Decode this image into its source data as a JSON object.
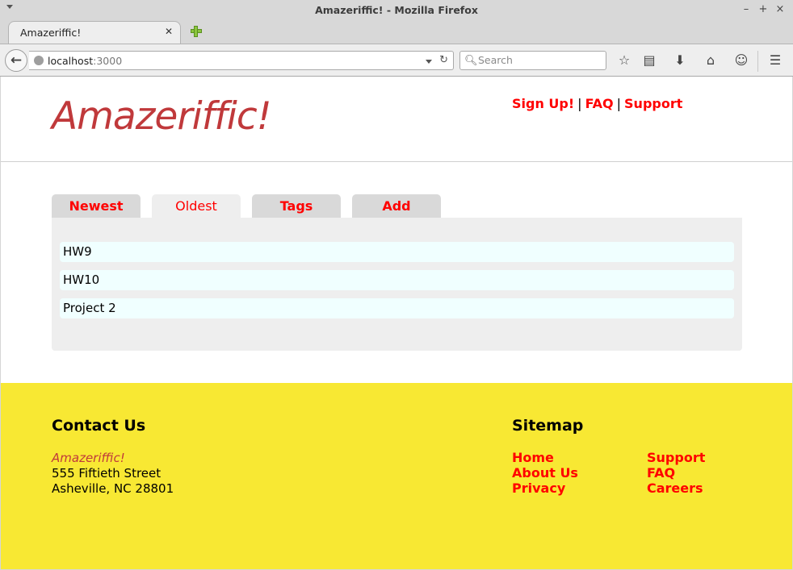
{
  "window": {
    "title": "Amazeriffic! - Mozilla Firefox",
    "controls": [
      "–",
      "+",
      "×"
    ]
  },
  "browser": {
    "tab_title": "Amazeriffic!",
    "url_host": "localhost",
    "url_port": ":3000",
    "search_placeholder": "Search"
  },
  "site": {
    "logo": "Amazeriffic!",
    "top_links": {
      "signup": "Sign Up!",
      "faq": "FAQ",
      "support": "Support",
      "separator": "|"
    },
    "tabs": [
      {
        "label": "Newest",
        "active": false
      },
      {
        "label": "Oldest",
        "active": true
      },
      {
        "label": "Tags",
        "active": false
      },
      {
        "label": "Add",
        "active": false
      }
    ],
    "items": [
      "HW9",
      "HW10",
      "Project 2"
    ]
  },
  "footer": {
    "contact_heading": "Contact Us",
    "address": {
      "company": "Amazeriffic!",
      "street": "555 Fiftieth Street",
      "city": "Asheville, NC 28801"
    },
    "sitemap_heading": "Sitemap",
    "sitemap_col1": [
      "Home",
      "About Us",
      "Privacy"
    ],
    "sitemap_col2": [
      "Support",
      "FAQ",
      "Careers"
    ]
  },
  "colors": {
    "logo": "#c0393b",
    "link": "#ff0000",
    "footer_bg": "#f8e833",
    "item_bg": "#f0ffff"
  }
}
